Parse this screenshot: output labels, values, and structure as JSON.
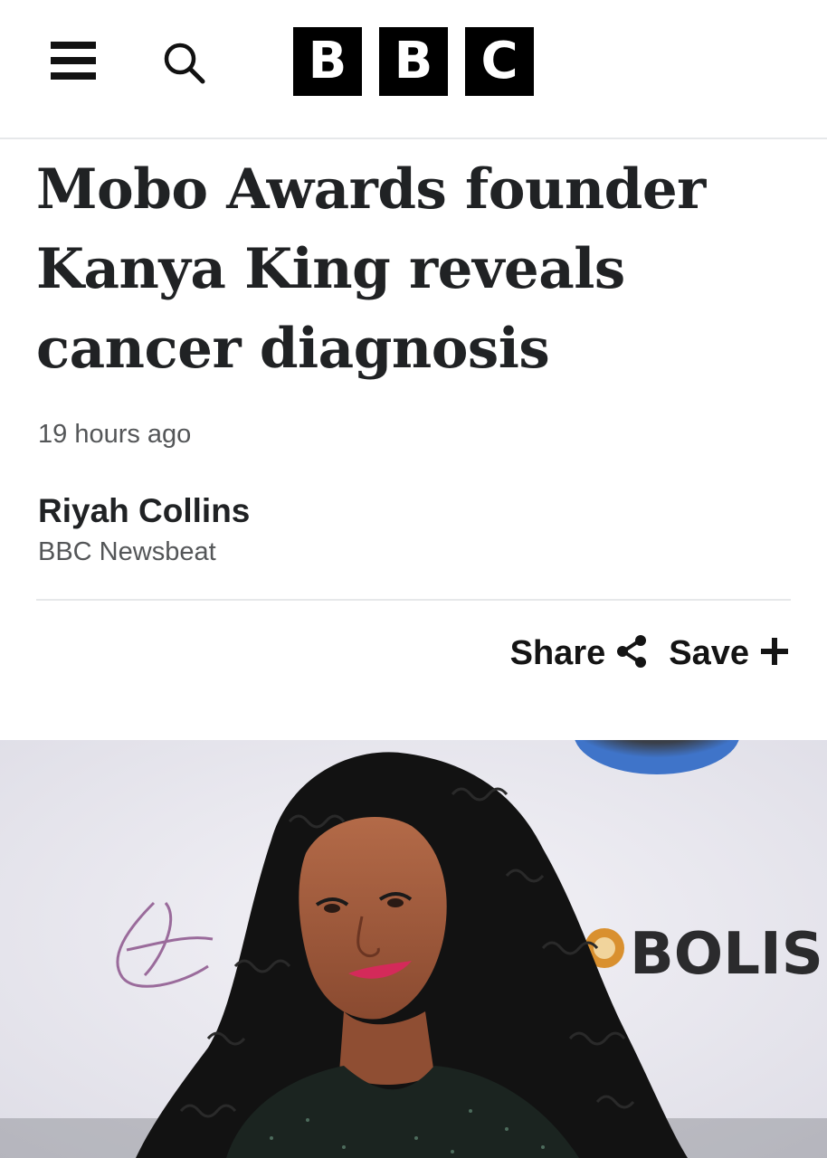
{
  "header": {
    "menu_icon": "hamburger-menu-icon",
    "search_icon": "search-icon",
    "logo_letters": [
      "B",
      "B",
      "C"
    ]
  },
  "article": {
    "headline": "Mobo Awards founder Kanya King reveals cancer diagnosis",
    "time": "19 hours ago",
    "author": "Riyah Collins",
    "outlet": "BBC Newsbeat"
  },
  "actions": {
    "share_label": "Share",
    "share_icon": "share-icon",
    "save_label": "Save",
    "save_icon": "plus-icon"
  },
  "hero": {
    "backdrop_text": "BOLISI"
  },
  "colors": {
    "text": "#202224",
    "muted": "#545658",
    "logo": "#000000",
    "divider": "#e6e8ea"
  }
}
